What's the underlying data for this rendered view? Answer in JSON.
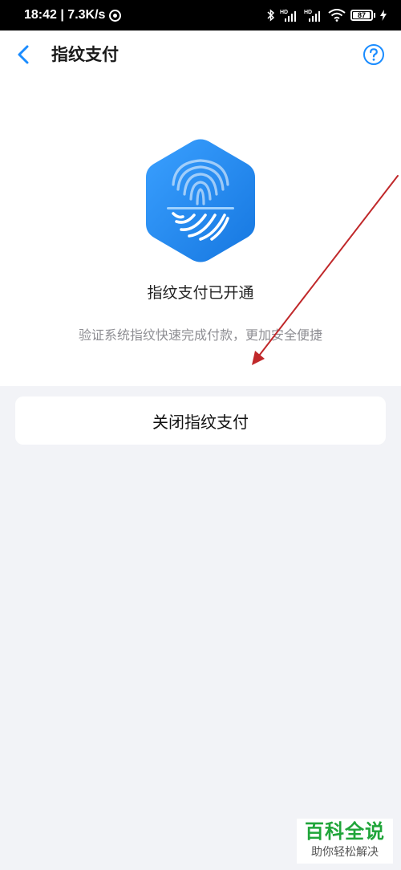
{
  "status_bar": {
    "time_speed": "18:42 | 7.3K/s",
    "battery_level": "87"
  },
  "nav": {
    "title": "指纹支付"
  },
  "fingerprint": {
    "status_title": "指纹支付已开通",
    "description": "验证系统指纹快速完成付款，更加安全便捷"
  },
  "actions": {
    "close_label": "关闭指纹支付"
  },
  "watermark": {
    "title": "百科全说",
    "subtitle": "助你轻松解决"
  },
  "colors": {
    "accent": "#1a8cff",
    "hex_light": "#3aa0ff",
    "hex_dark": "#1677e0",
    "page_bg": "#f2f3f7",
    "annotation": "#c0282a",
    "watermark_green": "#20a53a"
  }
}
